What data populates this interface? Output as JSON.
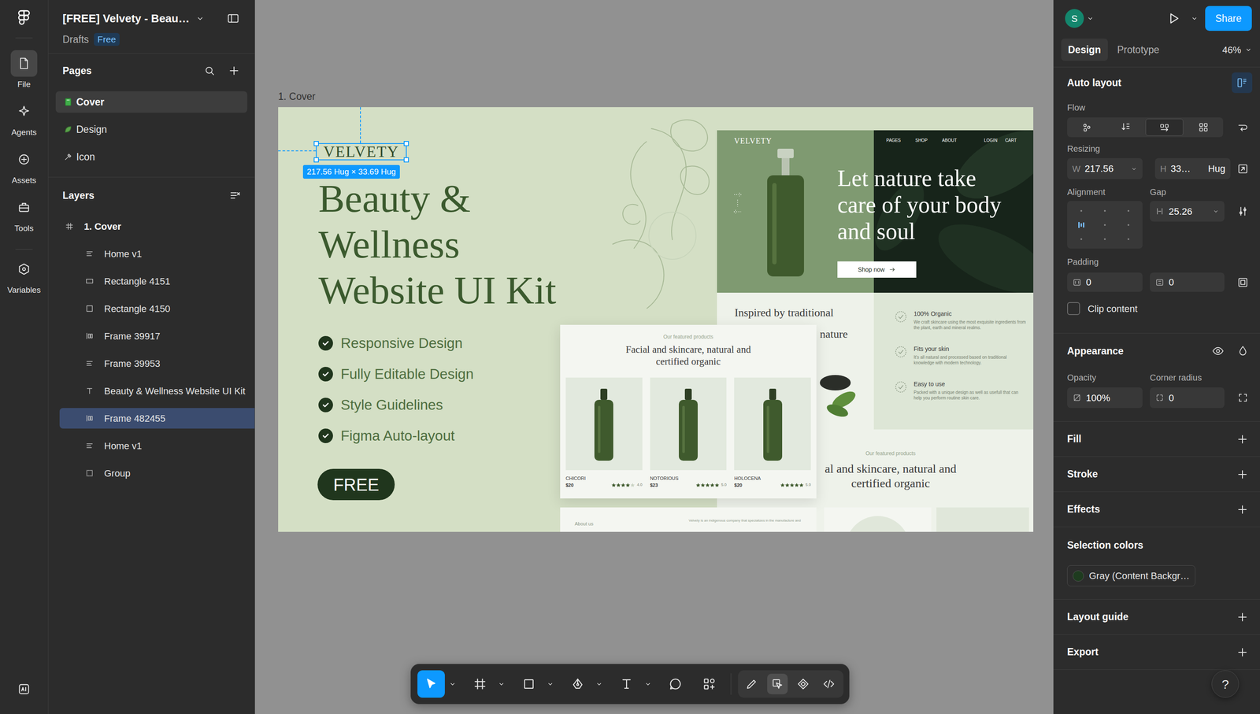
{
  "file": {
    "title": "[FREE] Velvety - Beau…",
    "location": "Drafts",
    "plan": "Free"
  },
  "rail": [
    {
      "label": "File",
      "kind": "file",
      "selected": true
    },
    {
      "label": "Agents",
      "kind": "agents",
      "selected": false
    },
    {
      "label": "Assets",
      "kind": "assets",
      "selected": false
    },
    {
      "label": "Tools",
      "kind": "tools",
      "selected": false
    },
    {
      "label": "Variables",
      "kind": "variables",
      "selected": false
    }
  ],
  "pages": {
    "title": "Pages",
    "items": [
      {
        "label": "Cover",
        "kind": "book",
        "selected": true
      },
      {
        "label": "Design",
        "kind": "leaf",
        "selected": false
      },
      {
        "label": "Icon",
        "kind": "tools",
        "selected": false
      }
    ]
  },
  "layers": {
    "title": "Layers",
    "items": [
      {
        "label": "1. Cover",
        "kind": "frame",
        "selected": false
      },
      {
        "label": "Home v1",
        "kind": "stack-v",
        "selected": false
      },
      {
        "label": "Rectangle 4151",
        "kind": "rect",
        "selected": false
      },
      {
        "label": "Rectangle 4150",
        "kind": "square",
        "selected": false
      },
      {
        "label": "Frame 39917",
        "kind": "stack-h",
        "selected": false
      },
      {
        "label": "Frame 39953",
        "kind": "stack-v",
        "selected": false
      },
      {
        "label": "Beauty & Wellness Website UI Kit",
        "kind": "text",
        "selected": false
      },
      {
        "label": "Frame 482455",
        "kind": "stack-h",
        "selected": true
      },
      {
        "label": "Home v1",
        "kind": "stack-v",
        "selected": false
      },
      {
        "label": "Group",
        "kind": "group",
        "selected": false
      }
    ]
  },
  "canvas": {
    "frame_label": "1. Cover",
    "selection_size": "217.56 Hug × 33.69 Hug",
    "cover": {
      "logo": "VELVETY",
      "title": [
        "Beauty &",
        "Wellness",
        "Website UI Kit"
      ],
      "features": [
        "Responsive Design",
        "Fully Editable Design",
        "Style Guidelines",
        "Figma Auto-layout"
      ],
      "cta": "FREE",
      "hero": {
        "brand": "VELVETY",
        "nav_left": [
          "PAGES",
          "SHOP",
          "ABOUT"
        ],
        "nav_right": [
          "LOGIN",
          "CART"
        ],
        "headline": [
          "Let nature take",
          "care of your body",
          "and soul"
        ],
        "button": "Shop now"
      },
      "about": {
        "heading": [
          "Inspired by traditional",
          "nature"
        ],
        "features": [
          {
            "title": "100% Organic",
            "text": "We craft skincare using the most exquisite ingredients from the plant, earth and mineral realms."
          },
          {
            "title": "Fits your skin",
            "text": "It's all natural and processed based on traditional knowledge with modern technology."
          },
          {
            "title": "Easy to use",
            "text": "Packed with a unique design as well as usefull that can help you perform routine skin care."
          }
        ]
      },
      "featured": {
        "eyebrow": "Our featured products",
        "heading": [
          "Facial and skincare, natural and",
          "certified organic"
        ],
        "products": [
          {
            "name": "CHICORI",
            "price": "$20",
            "stars": 4,
            "rating": "4.0"
          },
          {
            "name": "NOTORIOUS",
            "price": "$23",
            "stars": 5,
            "rating": "5.0"
          },
          {
            "name": "HOLOCENA",
            "price": "$20",
            "stars": 5,
            "rating": "5.0"
          }
        ]
      },
      "featured_back": {
        "eyebrow": "Our featured products",
        "heading": [
          "al and skincare, natural and",
          "certified organic"
        ]
      },
      "about_strip": {
        "label": "About us",
        "text": "Velvety is an indigenous company that specializes in the manufacture and"
      }
    }
  },
  "toolbar": {
    "tools": [
      {
        "kind": "move",
        "has_menu": true,
        "selected": true
      },
      {
        "kind": "frame",
        "has_menu": true,
        "selected": false
      },
      {
        "kind": "shape",
        "has_menu": true,
        "selected": false
      },
      {
        "kind": "pen",
        "has_menu": true,
        "selected": false
      },
      {
        "kind": "text",
        "has_menu": true,
        "selected": false
      },
      {
        "kind": "comment",
        "has_menu": false,
        "selected": false
      },
      {
        "kind": "actions",
        "has_menu": false,
        "selected": false
      }
    ],
    "modes": [
      {
        "kind": "draw",
        "selected": false
      },
      {
        "kind": "design",
        "selected": true
      },
      {
        "kind": "component",
        "selected": false
      },
      {
        "kind": "dev",
        "selected": false
      }
    ]
  },
  "inspector": {
    "avatar": "S",
    "share": "Share",
    "tabs": [
      {
        "label": "Design",
        "selected": true
      },
      {
        "label": "Prototype",
        "selected": false
      }
    ],
    "zoom": "46%",
    "auto_layout": {
      "title": "Auto layout",
      "flow_label": "Flow",
      "flow": [
        {
          "kind": "freeform",
          "selected": false
        },
        {
          "kind": "vertical",
          "selected": false
        },
        {
          "kind": "horizontal",
          "selected": true
        },
        {
          "kind": "grid",
          "selected": false
        }
      ],
      "resizing_label": "Resizing",
      "width": {
        "prefix": "W",
        "value": "217.56"
      },
      "height": {
        "prefix": "H",
        "value": "33…",
        "mode": "Hug"
      },
      "alignment_label": "Alignment",
      "alignment": [
        {
          "selected": false
        },
        {
          "selected": false
        },
        {
          "selected": false
        },
        {
          "selected": true
        },
        {
          "selected": false
        },
        {
          "selected": false
        },
        {
          "selected": false
        },
        {
          "selected": false
        },
        {
          "selected": false
        }
      ],
      "gap_label": "Gap",
      "gap": "25.26",
      "padding_label": "Padding",
      "padding_h": "0",
      "padding_v": "0",
      "clip": {
        "label": "Clip content",
        "checked": false
      }
    },
    "appearance": {
      "title": "Appearance",
      "opacity_label": "Opacity",
      "opacity": "100%",
      "radius_label": "Corner radius",
      "radius": "0"
    },
    "add_sections": [
      {
        "title": "Fill"
      },
      {
        "title": "Stroke"
      },
      {
        "title": "Effects"
      }
    ],
    "selection_colors": {
      "title": "Selection colors",
      "items": [
        {
          "label": "Gray (Content Backgr…",
          "color": "#1e3b1f"
        }
      ]
    },
    "more_sections": [
      {
        "title": "Layout guide"
      },
      {
        "title": "Export"
      }
    ],
    "help": "?"
  }
}
